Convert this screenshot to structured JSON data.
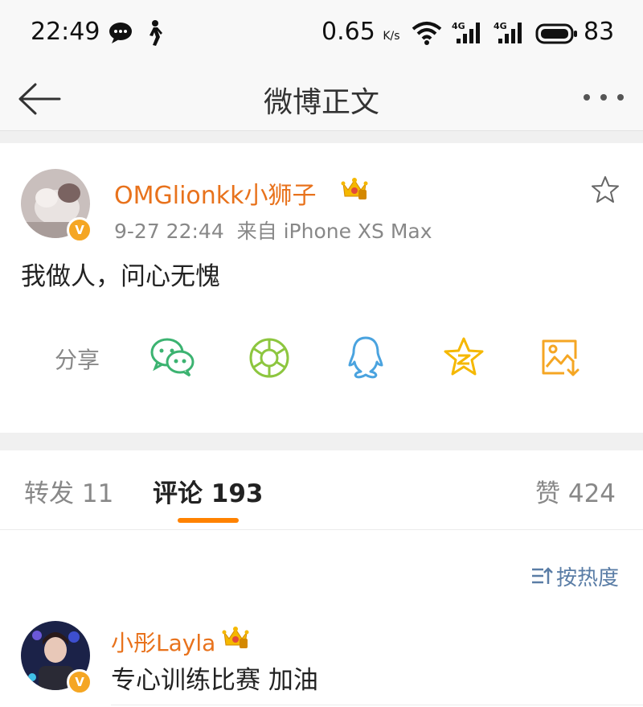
{
  "status_bar": {
    "time": "22:49",
    "speed_value": "0.65",
    "speed_unit": "K/s",
    "signal_1_label": "4G",
    "signal_2_label": "4G",
    "battery_percent": "83"
  },
  "nav": {
    "title": "微博正文"
  },
  "post": {
    "author": "OMGlionkk小狮子",
    "timestamp": "9-27 22:44",
    "source": "来自 iPhone XS Max",
    "text": "我做人，问心无愧",
    "share_label": "分享",
    "verified_badge": "V"
  },
  "tabs": {
    "repost_label": "转发 11",
    "comment_label": "评论 193",
    "like_label": "赞 424"
  },
  "comments": {
    "sort_label": "按热度",
    "items": [
      {
        "author": "小彤Layla",
        "text": "专心训练比赛 加油"
      }
    ]
  },
  "colors": {
    "accent": "#ff8200",
    "username": "#e8721c",
    "verified": "#f5a623",
    "wechat": "#3cb371",
    "moments": "#8dc63f",
    "qq": "#4aa3df",
    "qzone": "#f5b800",
    "save_image": "#f5a623"
  }
}
